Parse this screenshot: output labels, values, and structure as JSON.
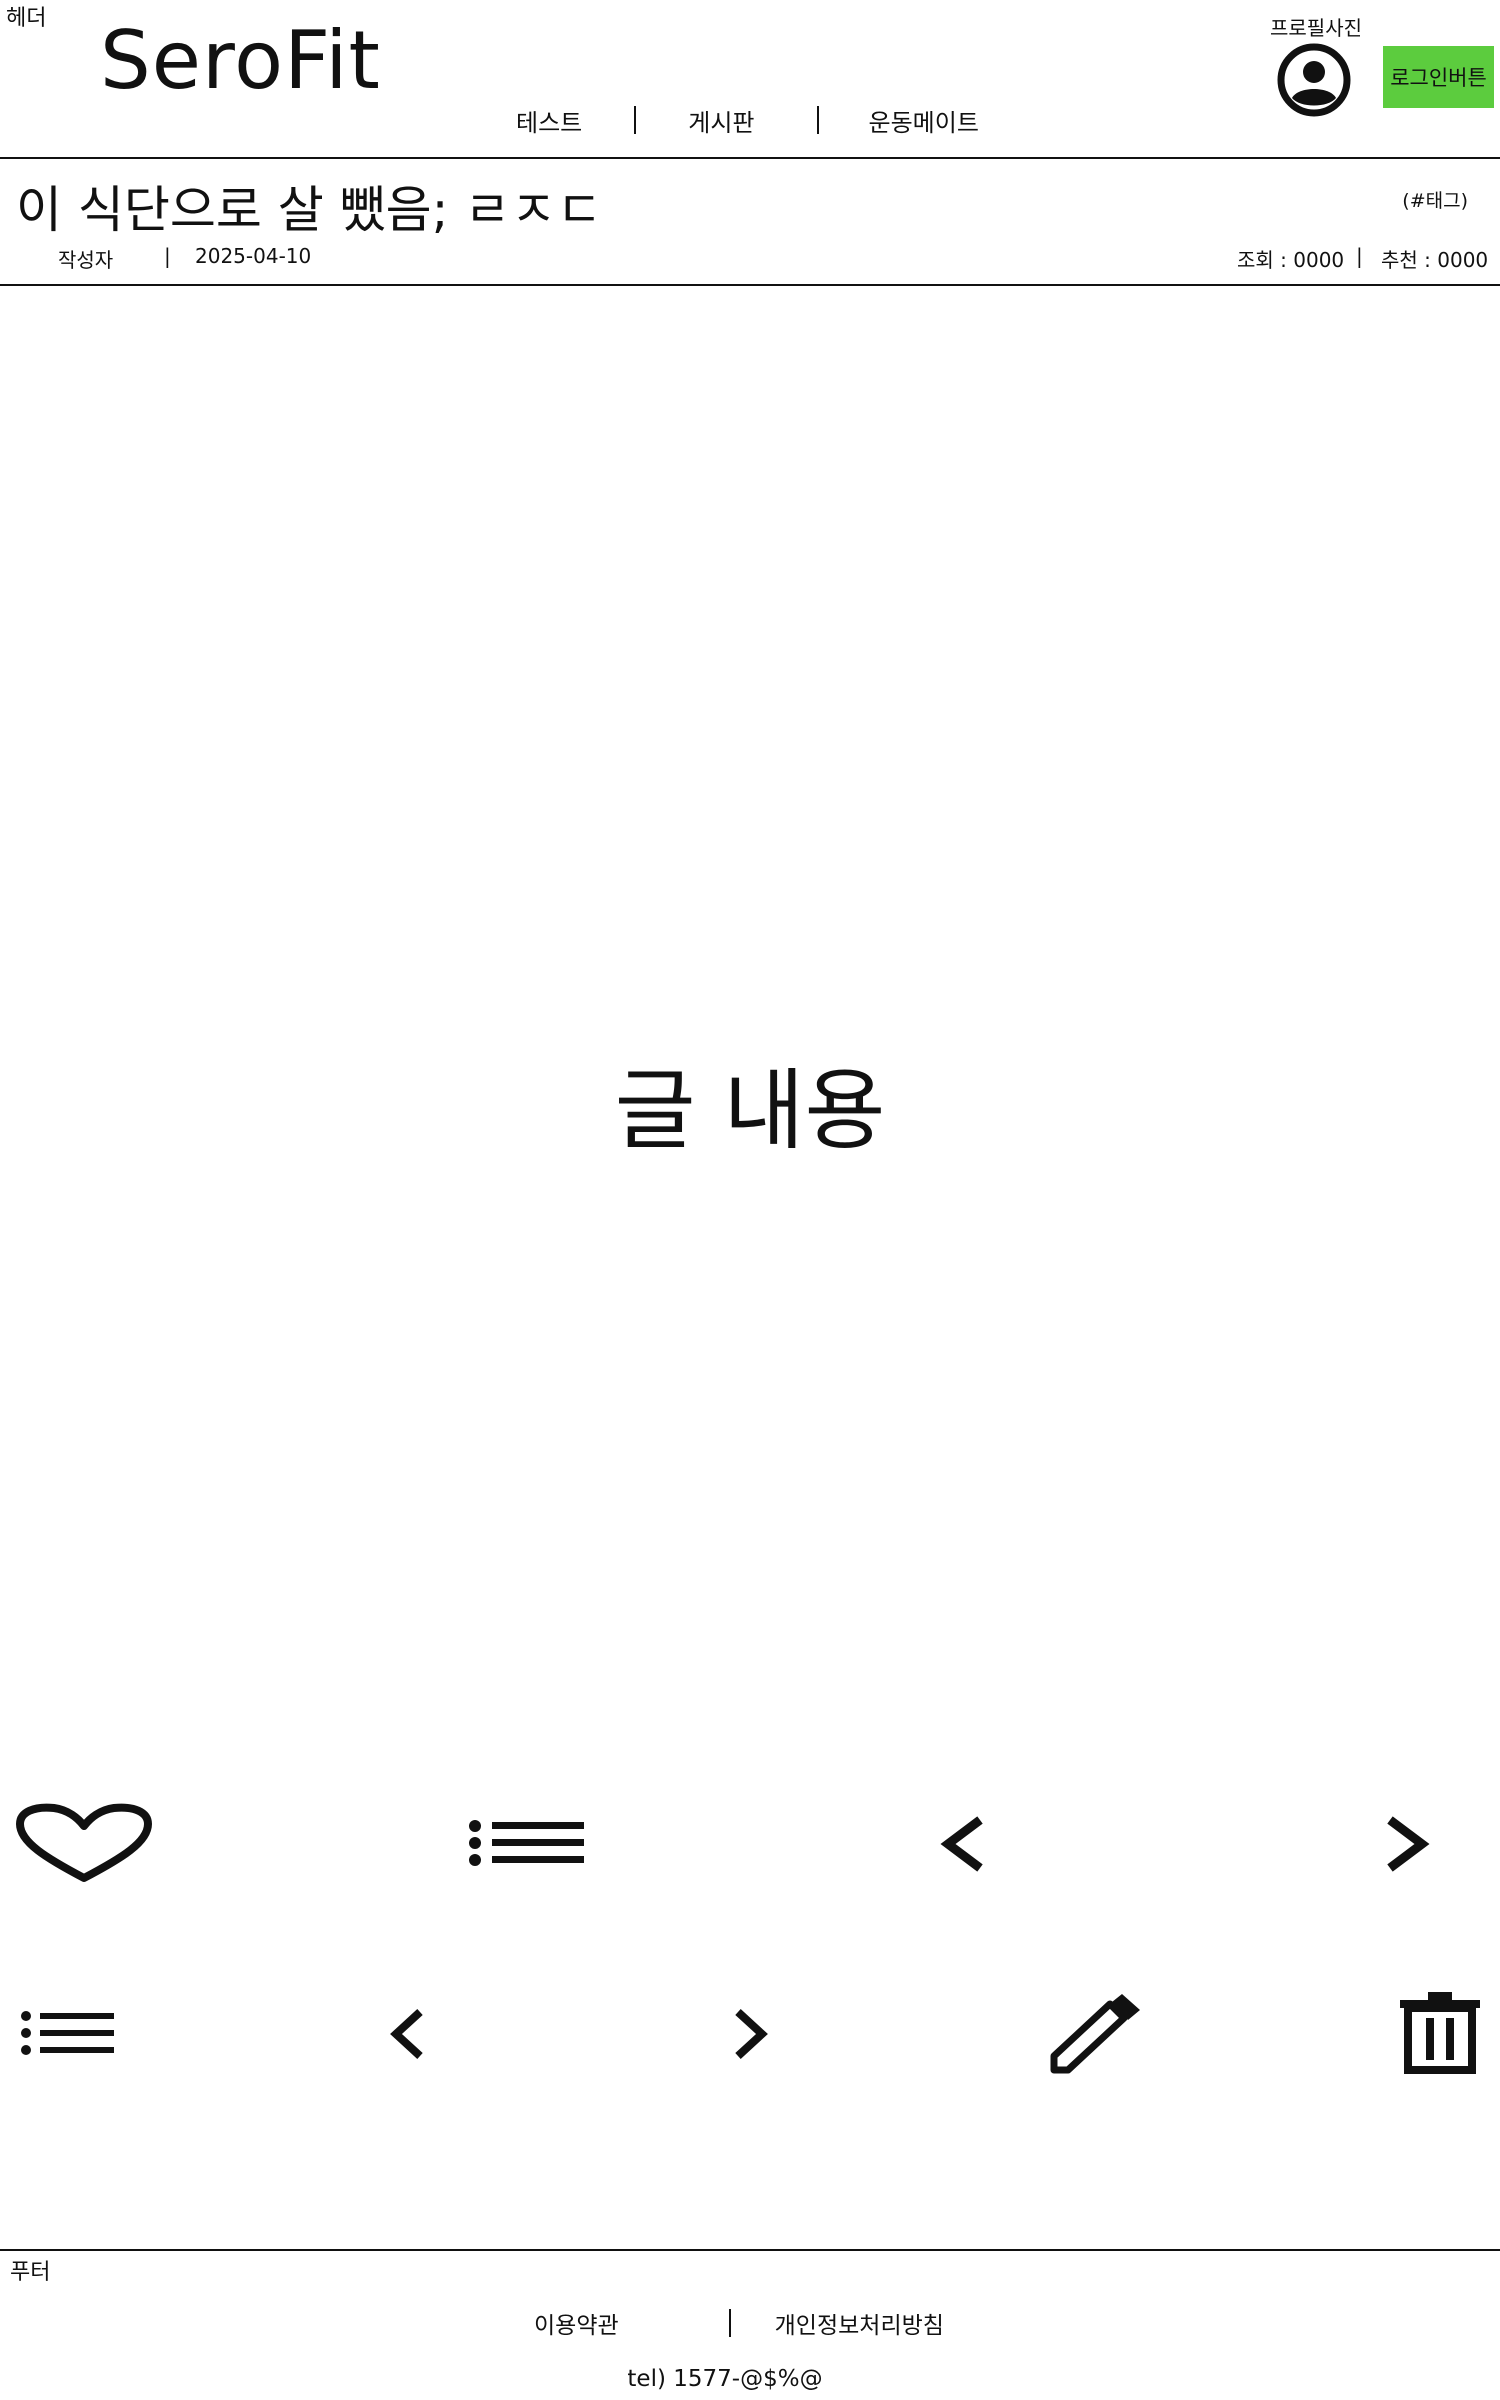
{
  "header": {
    "section_label": "헤더",
    "logo": "SeroFit",
    "nav": [
      "테스트",
      "게시판",
      "운동메이트"
    ],
    "profile_label": "프로필사진",
    "profile_icon": "user-avatar-icon",
    "login_button": "로그인버튼",
    "login_button_color": "#5ccc3e"
  },
  "post": {
    "title": "이 식단으로 살 뺐음; ㄹㅈㄷ",
    "tag": "(#태그)",
    "author": "작성자",
    "date": "2025-04-10",
    "views": "조회 : 0000",
    "likes": "추천 : 0000",
    "content": "글 내용"
  },
  "actions_row1": [
    "heart-icon",
    "list-icon",
    "chevron-left-icon",
    "chevron-right-icon"
  ],
  "actions_row2": [
    "list-icon",
    "chevron-left-icon",
    "chevron-right-icon",
    "pencil-icon",
    "trash-icon"
  ],
  "footer": {
    "section_label": "푸터",
    "terms": "이용약관",
    "privacy": "개인정보처리방침",
    "tel": "tel) 1577-@$%@"
  }
}
